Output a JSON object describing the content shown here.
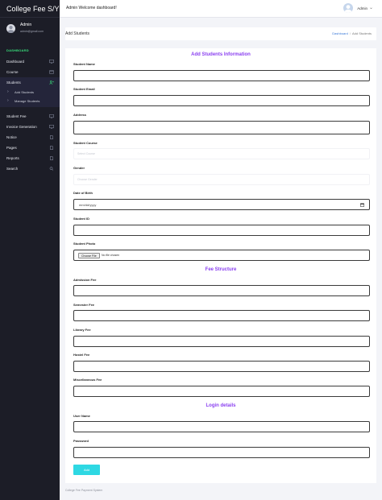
{
  "sidebar": {
    "brand": "College Fee S/Y",
    "user": {
      "name": "Admin",
      "email": "admin@gmail.com"
    },
    "section_label": "DASHBOARD",
    "items": [
      {
        "label": "Dashboard",
        "icon": "monitor-icon"
      },
      {
        "label": "Course",
        "icon": "box-icon"
      },
      {
        "label": "Students",
        "icon": "user-plus-icon"
      }
    ],
    "sub_items": [
      {
        "label": "Add Students"
      },
      {
        "label": "Manage Students"
      }
    ],
    "items_after": [
      {
        "label": "Student Fee",
        "icon": "monitor-icon"
      },
      {
        "label": "Invoice Generation",
        "icon": "monitor-icon"
      },
      {
        "label": "Notice",
        "icon": "file-icon"
      },
      {
        "label": "Pages",
        "icon": "file-icon"
      },
      {
        "label": "Reports",
        "icon": "file-icon"
      },
      {
        "label": "Search",
        "icon": "search-icon"
      }
    ]
  },
  "header": {
    "welcome": "Admin Welcome dashboard!",
    "admin_label": "Admin"
  },
  "page": {
    "title": "Add Students",
    "breadcrumb": {
      "link": "Dashboard",
      "sep": "/",
      "current": "Add Students"
    }
  },
  "form": {
    "section_student": "Add Students Information",
    "section_fee": "Fee Structure",
    "section_login": "Login details",
    "labels": {
      "name": "Student Name",
      "email": "Student Email",
      "address": "Address",
      "course": "Student Course",
      "gender": "Gender",
      "dob": "Date of Birth",
      "student_id": "Student ID",
      "photo": "Student Photo",
      "admission_fee": "Admission Fee",
      "semester_fee": "Semester Fee",
      "library_fee": "Library Fee",
      "hostel_fee": "Hostel Fee",
      "misc_fee": "Miscellaneous Fee",
      "username": "User Name",
      "password": "Password"
    },
    "course_placeholder": "Select Course",
    "gender_placeholder": "Choose Gender",
    "dob_placeholder": "mm/dd/yyyy",
    "file_button": "Choose File",
    "file_status": "No file chosen",
    "submit_label": "Add"
  },
  "footer": "College Fee Payment System"
}
